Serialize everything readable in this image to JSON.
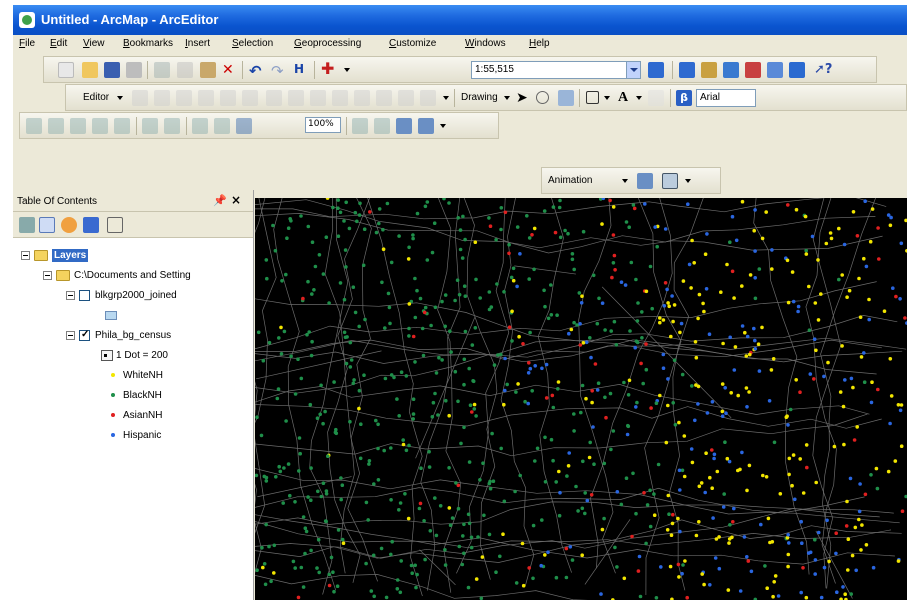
{
  "window": {
    "title": "Untitled - ArcMap - ArcEditor"
  },
  "menu": [
    "File",
    "Edit",
    "View",
    "Bookmarks",
    "Insert",
    "Selection",
    "Geoprocessing",
    "Customize",
    "Windows",
    "Help"
  ],
  "toolbar": {
    "scale_value": "1:55,515",
    "zoom_value": "100%"
  },
  "editor_toolbar": {
    "editor_label": "Editor",
    "drawing_label": "Drawing",
    "font_value": "Arial"
  },
  "animation_toolbar": {
    "animation_label": "Animation"
  },
  "toc": {
    "title": "Table Of Contents",
    "root_label": "Layers",
    "folder_label": "C:\\Documents and Setting",
    "layer1_label": "blkgrp2000_joined",
    "layer2_label": "Phila_bg_census",
    "dot_label": "1 Dot = 200",
    "legend": [
      {
        "label": "WhiteNH",
        "color": "#f2e600"
      },
      {
        "label": "BlackNH",
        "color": "#1f8f4a"
      },
      {
        "label": "AsianNH",
        "color": "#e02020"
      },
      {
        "label": "Hispanic",
        "color": "#2a66e0"
      }
    ]
  },
  "colors": {
    "title_bar": "#0a54cf",
    "toc_selection": "#316ac5",
    "map_background": "#000000",
    "boundary_lines": "#6b6b6b",
    "white_dots": "#f2e600",
    "black_dots": "#1f8f4a",
    "asian_dots": "#e02020",
    "hispanic_dots": "#2a66e0"
  }
}
